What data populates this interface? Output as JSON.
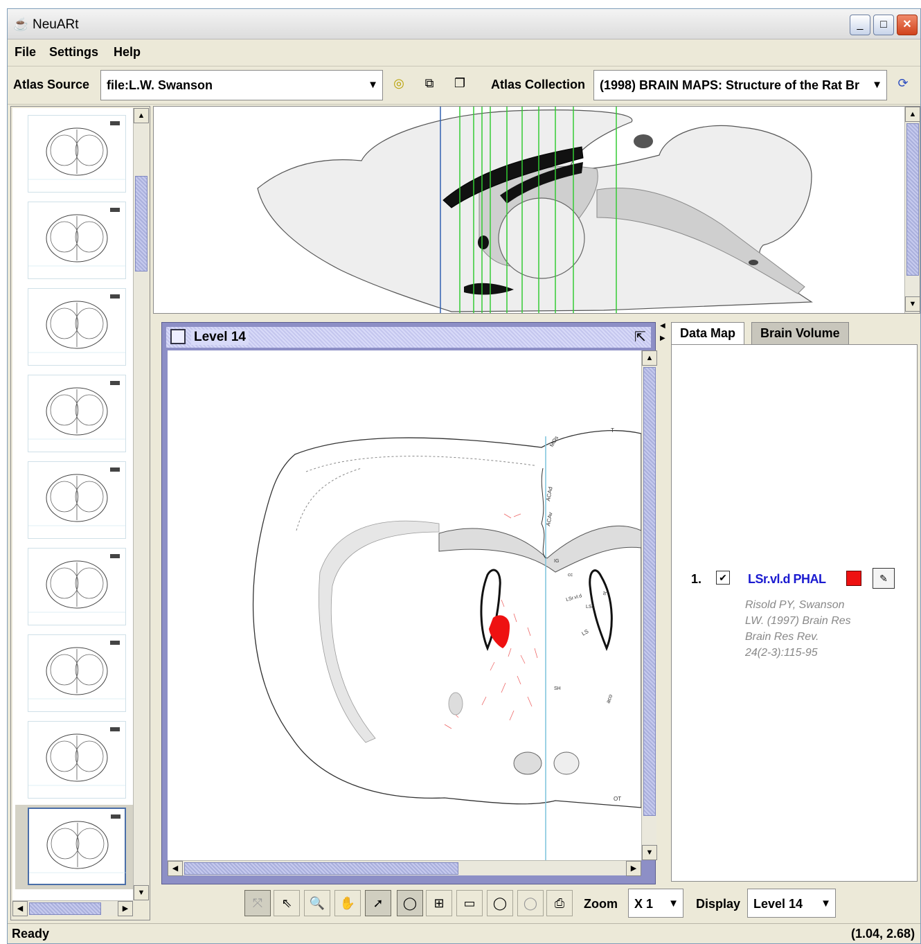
{
  "window": {
    "title": "NeuARt"
  },
  "menu": {
    "items": [
      "File",
      "Settings",
      "Help"
    ]
  },
  "toolbar": {
    "atlas_source_label": "Atlas Source",
    "atlas_source_value": "file:L.W. Swanson",
    "atlas_collection_label": "Atlas Collection",
    "atlas_collection_value": "(1998) BRAIN MAPS: Structure of the Rat Br"
  },
  "level_panel": {
    "title": "Level 14",
    "labels": {
      "t": "T",
      "mo": "MOs",
      "aca_d": "ACAd",
      "aca_v": "ACAv",
      "ig": "IG",
      "cc": "cc",
      "lsr": "LSr.vl.d",
      "ls": "LS",
      "lsc": "LSc",
      "sh": "SH",
      "aco": "aco",
      "st": "st",
      "ot": "OT"
    }
  },
  "tabs": {
    "data_map": "Data Map",
    "brain_volume": "Brain Volume"
  },
  "data_map": {
    "entries": [
      {
        "index": "1.",
        "name": "LSr.vl.d PHAL",
        "color": "#ee1111",
        "citation": [
          "Risold PY, Swanson",
          "LW. (1997) Brain Res",
          "Brain Res Rev.",
          "24(2-3):115-95"
        ]
      }
    ]
  },
  "bottom_toolbar": {
    "zoom_label": "Zoom",
    "zoom_value": "X 1",
    "display_label": "Display",
    "display_value": "Level 14"
  },
  "status": {
    "text": "Ready",
    "coords": "(1.04, 2.68)"
  },
  "colors": {
    "window_bg": "#ece9d8",
    "scroll_thumb": "#b4b8e4",
    "level_frame": "#8d8fc6",
    "section_lines": "#33cc33",
    "marker": "#ee1111",
    "link": "#1a1ad0"
  }
}
